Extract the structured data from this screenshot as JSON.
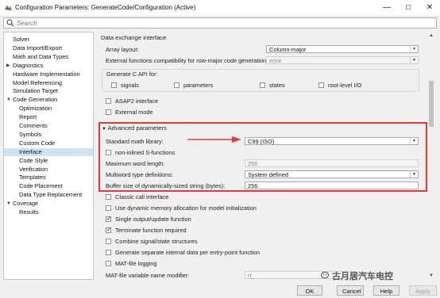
{
  "window": {
    "title": "Configuration Parameters: GenerateCode/Configuration (Active)",
    "minimize_glyph": "—",
    "maximize_glyph": "□",
    "close_glyph": "✕"
  },
  "search": {
    "placeholder": "Search"
  },
  "tree": [
    {
      "label": "Solver",
      "indent": 0,
      "arrow": ""
    },
    {
      "label": "Data Import/Export",
      "indent": 0,
      "arrow": ""
    },
    {
      "label": "Math and Data Types",
      "indent": 0,
      "arrow": ""
    },
    {
      "label": "Diagnostics",
      "indent": 0,
      "arrow": "▶"
    },
    {
      "label": "Hardware Implementation",
      "indent": 0,
      "arrow": ""
    },
    {
      "label": "Model Referencing",
      "indent": 0,
      "arrow": ""
    },
    {
      "label": "Simulation Target",
      "indent": 0,
      "arrow": ""
    },
    {
      "label": "Code Generation",
      "indent": 0,
      "arrow": "▼"
    },
    {
      "label": "Optimization",
      "indent": 1,
      "arrow": ""
    },
    {
      "label": "Report",
      "indent": 1,
      "arrow": ""
    },
    {
      "label": "Comments",
      "indent": 1,
      "arrow": ""
    },
    {
      "label": "Symbols",
      "indent": 1,
      "arrow": ""
    },
    {
      "label": "Custom Code",
      "indent": 1,
      "arrow": ""
    },
    {
      "label": "Interface",
      "indent": 1,
      "arrow": "",
      "selected": true
    },
    {
      "label": "Code Style",
      "indent": 1,
      "arrow": ""
    },
    {
      "label": "Verification",
      "indent": 1,
      "arrow": ""
    },
    {
      "label": "Templates",
      "indent": 1,
      "arrow": ""
    },
    {
      "label": "Code Placement",
      "indent": 1,
      "arrow": ""
    },
    {
      "label": "Data Type Replacement",
      "indent": 1,
      "arrow": ""
    },
    {
      "label": "Coverage",
      "indent": 0,
      "arrow": "▼"
    },
    {
      "label": "Results",
      "indent": 1,
      "arrow": ""
    }
  ],
  "pane": {
    "data_exchange_header": "Data exchange interface",
    "array_layout_label": "Array layout:",
    "array_layout_value": "Column-major",
    "ext_funcs_label": "External functions compatibility for row-major code generation:",
    "ext_funcs_value": "error",
    "c_api_header": "Generate C API for:",
    "c_api": {
      "signals": "signals",
      "parameters": "parameters",
      "states": "states",
      "root_level_io": "root-level I/O"
    },
    "asap2": "ASAP2 interface",
    "external_mode": "External mode",
    "advanced_header": "Advanced parameters",
    "std_math_label": "Standard math library:",
    "std_math_value": "C99 (ISO)",
    "non_inlined": "non-inlined S-functions",
    "max_word_label": "Maximum word length:",
    "max_word_value": "256",
    "multiword_label": "Multiword type definitions:",
    "multiword_value": "System defined",
    "buffer_label": "Buffer size of dynamically-sized string (bytes):",
    "buffer_value": "256",
    "classic_call": "Classic call interface",
    "dyn_mem": "Use dynamic memory allocation for model initialization",
    "single_output": "Single output/update function",
    "terminate": "Terminate function required",
    "combine": "Combine signal/state structures",
    "separate": "Generate separate internal data per entry-point function",
    "mat_logging": "MAT-file logging",
    "mat_modifier_label": "MAT-file variable name modifier:",
    "mat_modifier_value": "rt_",
    "dropdown_glyph": "▼"
  },
  "checks": {
    "single_output": true,
    "terminate": true
  },
  "buttons": {
    "ok": "OK",
    "cancel": "Cancel",
    "help": "Help",
    "apply": "Apply"
  },
  "watermark": "古月居汽车电控",
  "colors": {
    "highlight_border": "#e23a3a",
    "selected_tree": "#cde4f7"
  }
}
